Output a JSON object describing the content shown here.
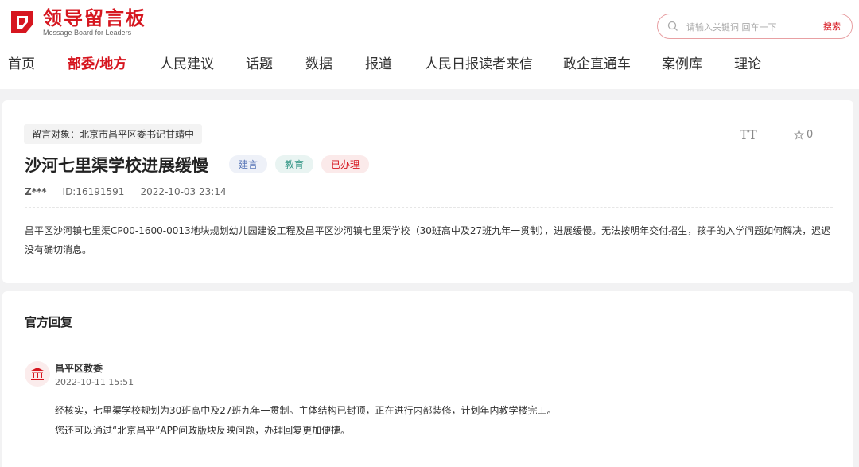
{
  "brand": {
    "title": "领导留言板",
    "subtitle": "Message Board for Leaders",
    "color": "#d6161f"
  },
  "search": {
    "placeholder": "请输入关键词 回车一下",
    "button": "搜索"
  },
  "nav": {
    "items": [
      "首页",
      "部委/地方",
      "人民建议",
      "话题",
      "数据",
      "报道",
      "人民日报读者来信",
      "政企直通车",
      "案例库",
      "理论"
    ],
    "active": "部委/地方"
  },
  "message": {
    "target": "留言对象：北京市昌平区委书记甘靖中",
    "title": "沙河七里渠学校进展缓慢",
    "tags": [
      "建言",
      "教育",
      "已办理"
    ],
    "font_toggle": "TT",
    "favorite_count": "0",
    "author": "Z***",
    "id": "ID:16191591",
    "time": "2022-10-03 23:14",
    "content": "昌平区沙河镇七里渠CP00-1600-0013地块规划幼儿园建设工程及昌平区沙河镇七里渠学校（30班高中及27班九年一贯制），进展缓慢。无法按明年交付招生，孩子的入学问题如何解决，迟迟没有确切消息。"
  },
  "reply": {
    "heading": "官方回复",
    "org": "昌平区教委",
    "time": "2022-10-11 15:51",
    "lines": [
      "经核实，七里渠学校规划为30班高中及27班九年一贯制。主体结构已封顶，正在进行内部装修，计划年内教学楼完工。",
      "您还可以通过“北京昌平”APP问政版块反映问题，办理回复更加便捷。"
    ]
  }
}
